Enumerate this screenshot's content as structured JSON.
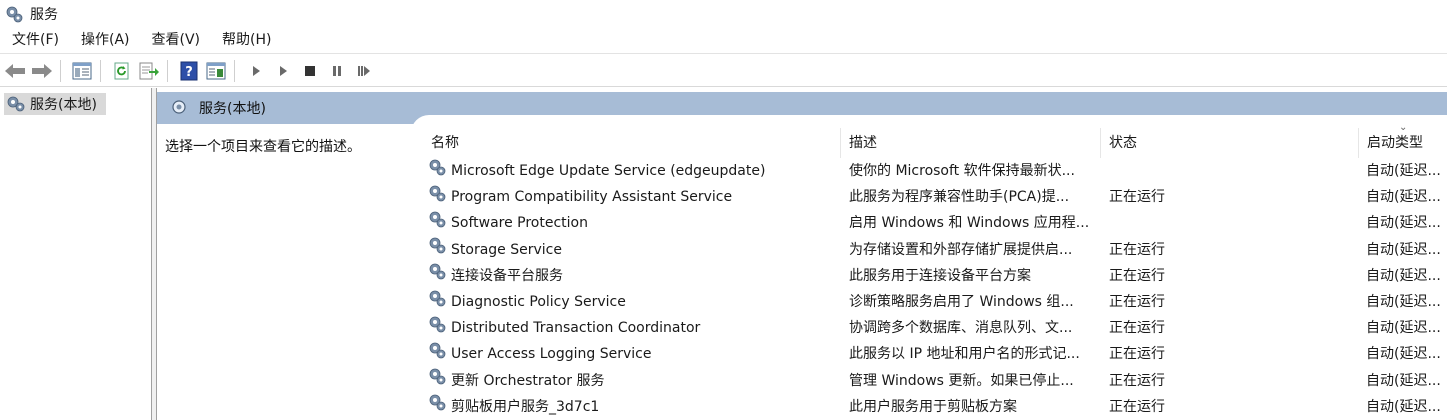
{
  "window": {
    "title": "服务",
    "icon": "gear-icon"
  },
  "menu": [
    "文件(F)",
    "操作(A)",
    "查看(V)",
    "帮助(H)"
  ],
  "toolbar": {
    "buttons": [
      "back-arrow-icon",
      "forward-arrow-icon",
      "show-hide-tree-icon",
      "refresh-icon",
      "export-list-icon",
      "help-icon",
      "properties-icon",
      "play-icon",
      "play-alt-icon",
      "stop-icon",
      "pause-icon",
      "restart-icon"
    ]
  },
  "tree": {
    "root_label": "服务(本地)"
  },
  "pane": {
    "header_title": "服务(本地)",
    "description_hint": "选择一个项目来查看它的描述。"
  },
  "list": {
    "columns": {
      "name": "名称",
      "description": "描述",
      "status": "状态",
      "startup": "启动类型"
    },
    "rows": [
      {
        "name": "Microsoft Edge Update Service (edgeupdate)",
        "description": "使你的 Microsoft 软件保持最新状...",
        "status": "",
        "startup": "自动(延迟..."
      },
      {
        "name": "Program Compatibility Assistant Service",
        "description": "此服务为程序兼容性助手(PCA)提...",
        "status": "正在运行",
        "startup": "自动(延迟..."
      },
      {
        "name": "Software Protection",
        "description": "启用 Windows 和 Windows 应用程...",
        "status": "",
        "startup": "自动(延迟..."
      },
      {
        "name": "Storage Service",
        "description": "为存储设置和外部存储扩展提供启...",
        "status": "正在运行",
        "startup": "自动(延迟..."
      },
      {
        "name": "连接设备平台服务",
        "description": "此服务用于连接设备平台方案",
        "status": "正在运行",
        "startup": "自动(延迟..."
      },
      {
        "name": "Diagnostic Policy Service",
        "description": "诊断策略服务启用了 Windows 组...",
        "status": "正在运行",
        "startup": "自动(延迟..."
      },
      {
        "name": "Distributed Transaction Coordinator",
        "description": "协调跨多个数据库、消息队列、文...",
        "status": "正在运行",
        "startup": "自动(延迟..."
      },
      {
        "name": "User Access Logging Service",
        "description": "此服务以 IP 地址和用户名的形式记...",
        "status": "正在运行",
        "startup": "自动(延迟..."
      },
      {
        "name": "更新 Orchestrator 服务",
        "description": "管理 Windows 更新。如果已停止...",
        "status": "正在运行",
        "startup": "自动(延迟..."
      },
      {
        "name": "剪贴板用户服务_3d7c1",
        "description": "此用户服务用于剪贴板方案",
        "status": "正在运行",
        "startup": "自动(延迟..."
      }
    ]
  },
  "colors": {
    "header_bar": "#a7bcd6",
    "selected_tree": "#d9d9d9"
  }
}
